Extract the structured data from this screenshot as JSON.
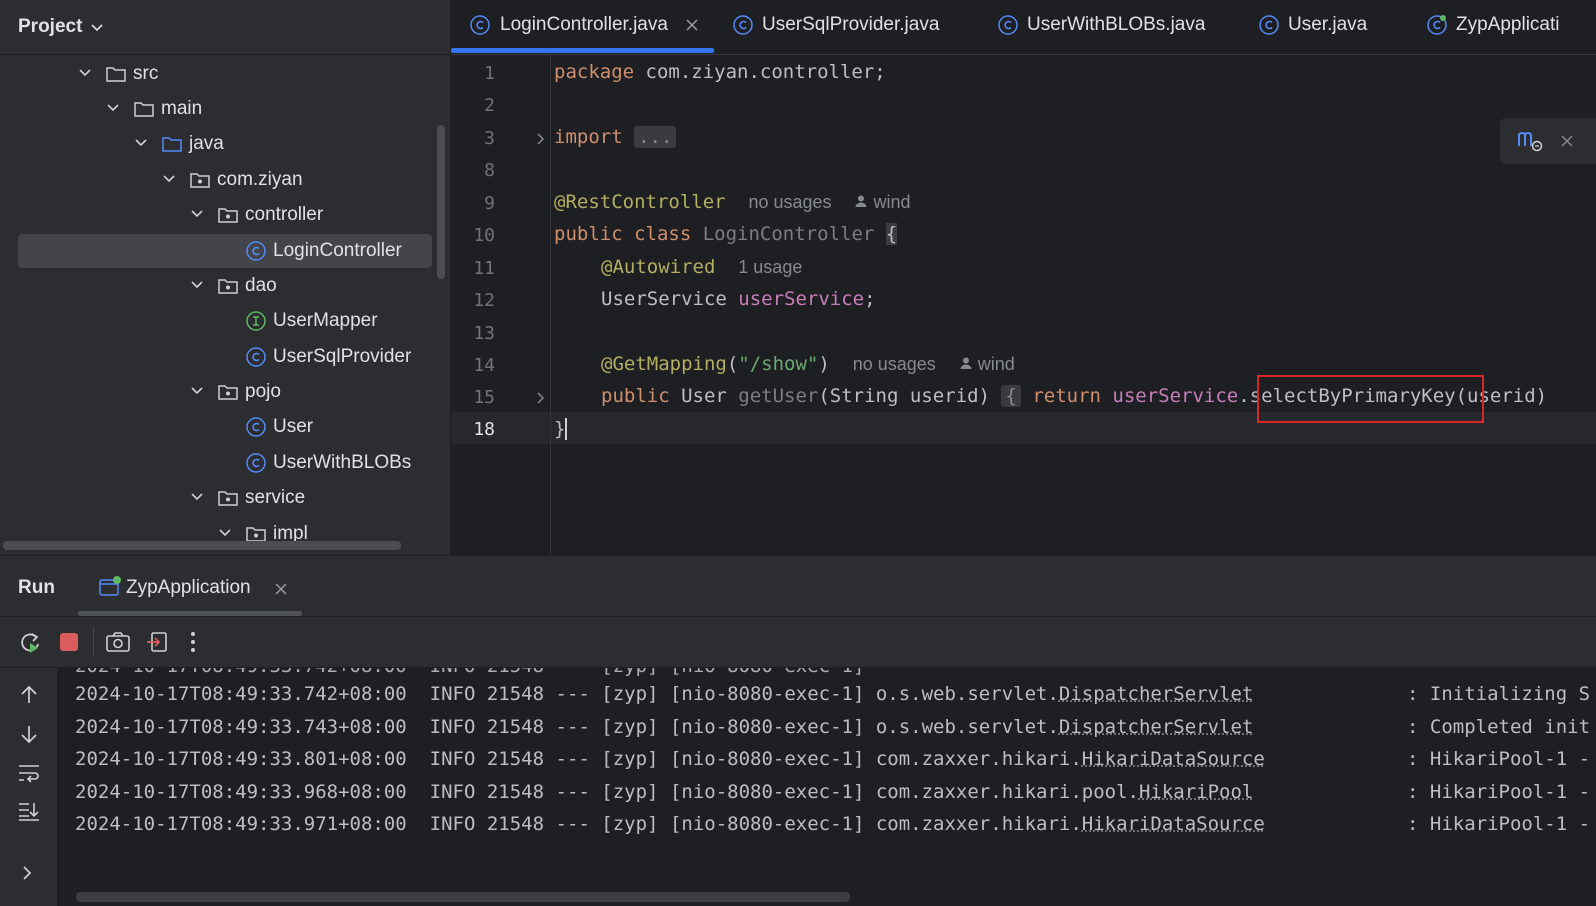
{
  "project_panel": {
    "title": "Project",
    "tree": [
      {
        "label": "src",
        "type": "folder"
      },
      {
        "label": "main",
        "type": "folder"
      },
      {
        "label": "java",
        "type": "source-folder"
      },
      {
        "label": "com.ziyan",
        "type": "package"
      },
      {
        "label": "controller",
        "type": "package"
      },
      {
        "label": "LoginController",
        "type": "class",
        "selected": true
      },
      {
        "label": "dao",
        "type": "package"
      },
      {
        "label": "UserMapper",
        "type": "interface"
      },
      {
        "label": "UserSqlProvider",
        "type": "class"
      },
      {
        "label": "pojo",
        "type": "package"
      },
      {
        "label": "User",
        "type": "class"
      },
      {
        "label": "UserWithBLOBs",
        "type": "class"
      },
      {
        "label": "service",
        "type": "package"
      },
      {
        "label": "impl",
        "type": "package"
      }
    ]
  },
  "editor": {
    "tabs": [
      {
        "label": "LoginController.java",
        "active": true
      },
      {
        "label": "UserSqlProvider.java"
      },
      {
        "label": "UserWithBLOBs.java"
      },
      {
        "label": "User.java"
      },
      {
        "label": "ZypApplicati"
      }
    ],
    "line_numbers": [
      "1",
      "2",
      "3",
      "8",
      "9",
      "10",
      "11",
      "12",
      "13",
      "14",
      "15",
      "18"
    ],
    "code": {
      "l1_kw": "package",
      "l1_rest": " com.ziyan.controller;",
      "l3_kw": "import",
      "l3_fold": "...",
      "l9_ann": "@RestController",
      "l9_hint": "no usages",
      "l9_author": "wind",
      "l10_kw": "public class",
      "l10_name": "LoginController",
      "l10_brace": "{",
      "l11_ann": "@Autowired",
      "l11_hint": "1 usage",
      "l12_type": "UserService",
      "l12_field": "userService",
      "l12_end": ";",
      "l14_ann": "@GetMapping",
      "l14_open": "(",
      "l14_str": "\"/show\"",
      "l14_close": ")",
      "l14_hint": "no usages",
      "l14_author": "wind",
      "l15_kw": "public",
      "l15_type": " User ",
      "l15_fn": "getUser",
      "l15_params": "(String userid)",
      "l15_brace": "{",
      "l15_ret": "return",
      "l15_field": "userService",
      "l15_dot": ".",
      "l15_call": "selectByPrimaryKey",
      "l15_args": "(userid)",
      "l18": "}"
    }
  },
  "run_panel": {
    "title": "Run",
    "tab_label": "ZypApplication",
    "logs": [
      {
        "time": "2024-10-17T08:49:33.742+08:00",
        "level": "INFO",
        "pid": "21548",
        "sep": "---",
        "app": "[zyp]",
        "thread": "[nio-8080-exec-1]",
        "pkg": "o.s.web.servlet.",
        "cls": "DispatcherServlet",
        "msg": ": Initializing S"
      },
      {
        "time": "2024-10-17T08:49:33.743+08:00",
        "level": "INFO",
        "pid": "21548",
        "sep": "---",
        "app": "[zyp]",
        "thread": "[nio-8080-exec-1]",
        "pkg": "o.s.web.servlet.",
        "cls": "DispatcherServlet",
        "msg": ": Completed init"
      },
      {
        "time": "2024-10-17T08:49:33.801+08:00",
        "level": "INFO",
        "pid": "21548",
        "sep": "---",
        "app": "[zyp]",
        "thread": "[nio-8080-exec-1]",
        "pkg": "com.zaxxer.hikari.",
        "cls": "HikariDataSource",
        "msg": ": HikariPool-1 -"
      },
      {
        "time": "2024-10-17T08:49:33.968+08:00",
        "level": "INFO",
        "pid": "21548",
        "sep": "---",
        "app": "[zyp]",
        "thread": "[nio-8080-exec-1]",
        "pkg": "com.zaxxer.hikari.pool.",
        "cls": "HikariPool",
        "msg": ": HikariPool-1 -"
      },
      {
        "time": "2024-10-17T08:49:33.971+08:00",
        "level": "INFO",
        "pid": "21548",
        "sep": "---",
        "app": "[zyp]",
        "thread": "[nio-8080-exec-1]",
        "pkg": "com.zaxxer.hikari.",
        "cls": "HikariDataSource",
        "msg": ": HikariPool-1 -"
      }
    ]
  },
  "colors": {
    "accent": "#3574f0",
    "highlight_box": "#d8262b",
    "keyword": "#cf8e6d",
    "annotation": "#b3ae60",
    "field": "#c77dbb",
    "string": "#6aab73"
  }
}
